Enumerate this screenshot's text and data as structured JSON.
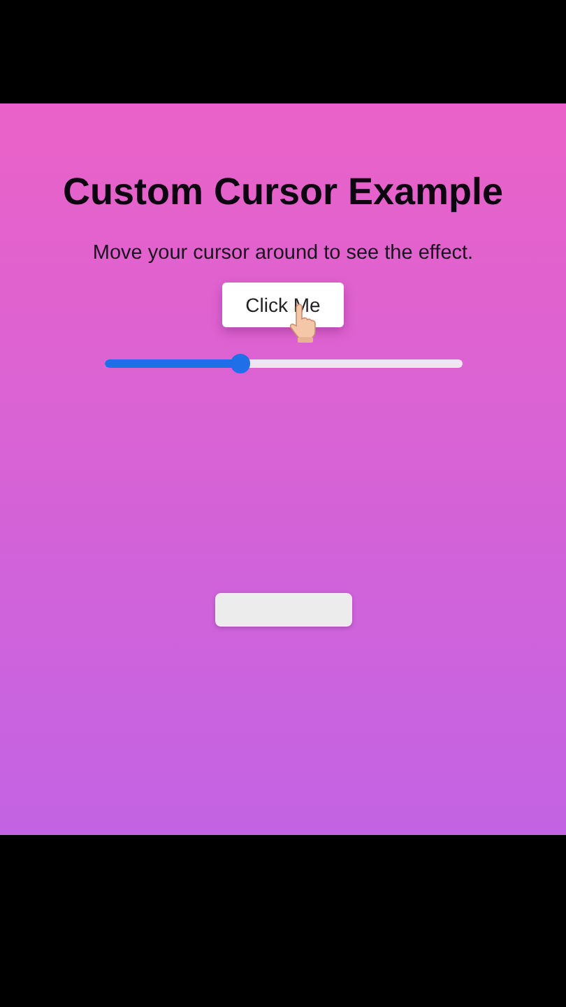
{
  "title": "Custom Cursor Example",
  "subtitle": "Move your cursor around to see the effect.",
  "button": {
    "label": "Click Me"
  },
  "slider": {
    "level": 0.38
  },
  "field": {
    "kind": "input"
  }
}
